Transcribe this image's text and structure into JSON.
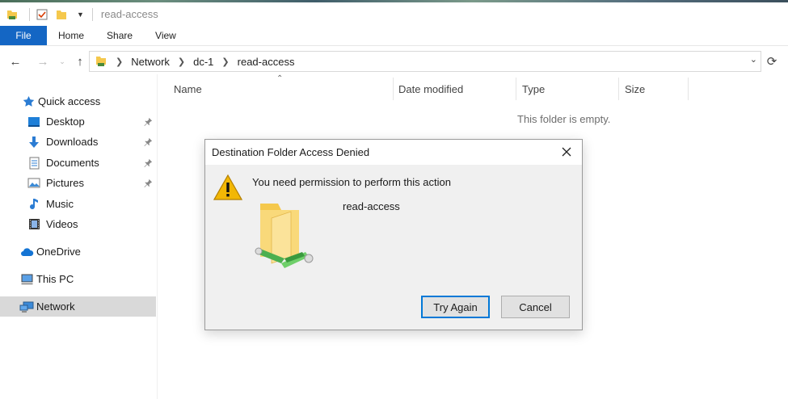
{
  "window": {
    "title": "read-access"
  },
  "ribbon": {
    "tabs": [
      "File",
      "Home",
      "Share",
      "View"
    ]
  },
  "address": {
    "crumbs": [
      "Network",
      "dc-1",
      "read-access"
    ]
  },
  "sidebar": {
    "items": [
      {
        "label": "Quick access",
        "icon": "star-icon"
      },
      {
        "label": "Desktop",
        "icon": "desktop-icon",
        "pinned": true
      },
      {
        "label": "Downloads",
        "icon": "download-arrow-icon",
        "pinned": true
      },
      {
        "label": "Documents",
        "icon": "document-icon",
        "pinned": true
      },
      {
        "label": "Pictures",
        "icon": "picture-icon",
        "pinned": true
      },
      {
        "label": "Music",
        "icon": "music-note-icon"
      },
      {
        "label": "Videos",
        "icon": "film-icon"
      },
      {
        "label": "OneDrive",
        "icon": "cloud-icon"
      },
      {
        "label": "This PC",
        "icon": "computer-icon"
      },
      {
        "label": "Network",
        "icon": "network-icon",
        "selected": true
      }
    ]
  },
  "columns": [
    "Name",
    "Date modified",
    "Type",
    "Size"
  ],
  "content": {
    "empty_message": "This folder is empty."
  },
  "dialog": {
    "title": "Destination Folder Access Denied",
    "message": "You need permission to perform this action",
    "folder_name": "read-access",
    "buttons": {
      "primary": "Try Again",
      "secondary": "Cancel"
    }
  },
  "colors": {
    "file_tab": "#1466c4",
    "selection": "#d9d9d9",
    "focus": "#0078d7",
    "folder": "#f5c84c"
  }
}
